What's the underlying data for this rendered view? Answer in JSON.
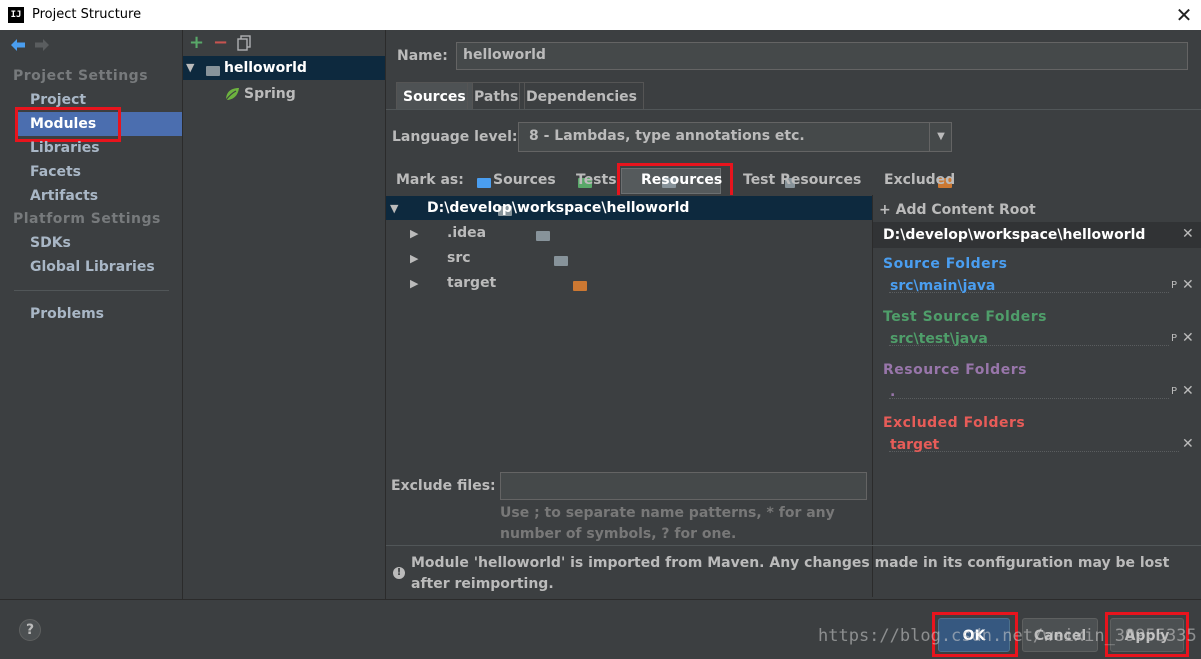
{
  "window": {
    "title": "Project Structure",
    "app_icon": "IJ"
  },
  "nav": {
    "project_settings": "Project Settings",
    "items_project": [
      "Project",
      "Modules",
      "Libraries",
      "Facets",
      "Artifacts"
    ],
    "platform_settings": "Platform Settings",
    "items_platform": [
      "SDKs",
      "Global Libraries"
    ],
    "problems": "Problems"
  },
  "modules": {
    "root": "helloworld",
    "child": "Spring"
  },
  "details": {
    "name_label": "Name:",
    "name_value": "helloworld",
    "tabs": [
      "Sources",
      "Paths",
      "Dependencies"
    ],
    "language_label": "Language level:",
    "language_value": "8 - Lambdas, type annotations etc.",
    "mark_as_label": "Mark as:",
    "mark_as": [
      "Sources",
      "Tests",
      "Resources",
      "Test Resources",
      "Excluded"
    ],
    "tree": {
      "root": "D:\\develop\\workspace\\helloworld",
      "children": [
        ".idea",
        "src",
        "target"
      ]
    },
    "exclude_label": "Exclude files:",
    "exclude_hint": "Use ; to separate name patterns, * for any number of symbols, ? for one.",
    "content_root": {
      "add_label": "Add Content Root",
      "path": "D:\\develop\\workspace\\helloworld",
      "source_title": "Source Folders",
      "source_path": "src\\main\\java",
      "test_title": "Test Source Folders",
      "test_path": "src\\test\\java",
      "resource_title": "Resource Folders",
      "resource_path": ".",
      "excluded_title": "Excluded Folders",
      "excluded_path": "target",
      "props_glyph": "P",
      "remove_glyph": "✕"
    },
    "notice": "Module 'helloworld' is imported from Maven. Any changes made in its configuration may be lost after reimporting."
  },
  "footer": {
    "help": "?",
    "ok": "OK",
    "cancel": "Cancel",
    "apply": "Apply",
    "watermark": "https://blog.csdn.net/weixin_39955335"
  },
  "colors": {
    "source": "#4a9ef0",
    "test": "#4f9e6a",
    "resource": "#9876aa",
    "excluded": "#e75c58",
    "selection": "#4b6eaf",
    "highlight": "#e8141d"
  }
}
